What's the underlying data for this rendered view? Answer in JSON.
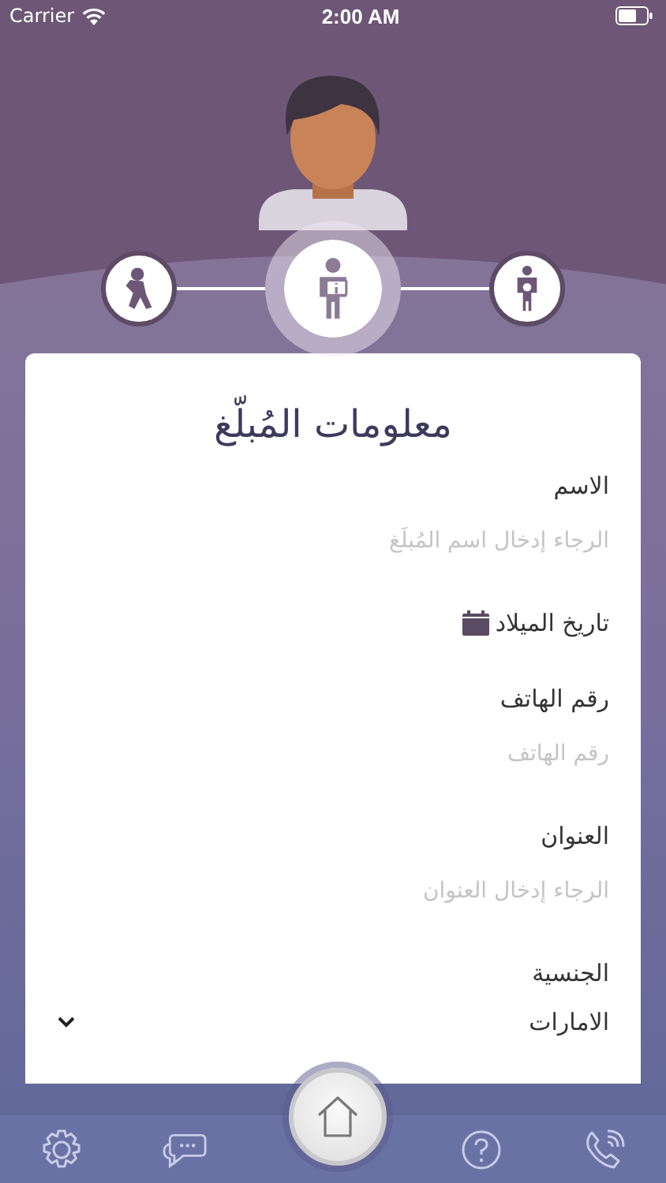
{
  "status_bar": {
    "carrier": "Carrier",
    "time": "2:00 AM"
  },
  "steps": [
    {
      "selected": false
    },
    {
      "selected": true
    },
    {
      "selected": false
    }
  ],
  "card": {
    "title": "معلومات المُبلّغ",
    "fields": [
      {
        "kind": "input",
        "label": "الاسم",
        "placeholder": "الرجاء إدخال اسم المُبلَغ"
      },
      {
        "kind": "date",
        "label": "تاريخ الميلاد"
      },
      {
        "kind": "input",
        "label": "رقم الهاتف",
        "placeholder": "رقم الهاتف"
      },
      {
        "kind": "input",
        "label": "العنوان",
        "placeholder": "الرجاء إدخال العنوان"
      },
      {
        "kind": "select",
        "label": "الجنسية",
        "value": "الامارات"
      }
    ]
  }
}
